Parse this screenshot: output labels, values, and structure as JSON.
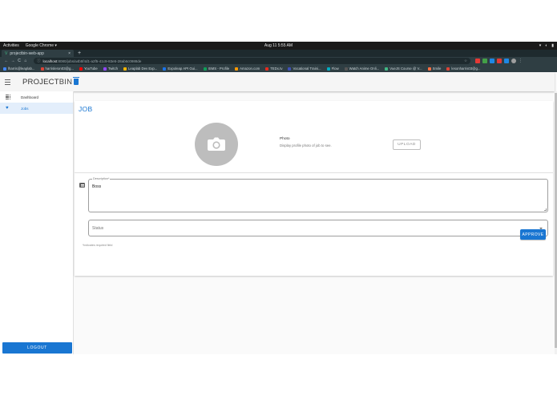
{
  "gnome": {
    "activities": "Activities",
    "app": "Google Chrome ▾",
    "clock": "Aug 11  5:55 AM",
    "tray": [
      "▾",
      "◐",
      "▮"
    ]
  },
  "browser": {
    "tab_title": "projectbin-web-app",
    "tab_close": "×",
    "new_tab": "+",
    "url_host": "localhost",
    "url_path": ":8080/jobs/a4b5f4d1-a2f5-41c9-83e5-28ab6c0988de",
    "nav": {
      "back": "←",
      "forward": "→",
      "reload": "C",
      "home": "⌂"
    }
  },
  "bookmarks": [
    {
      "label": "lharris@leaplab...",
      "color": "#4285f4"
    },
    {
      "label": "harrisleron03@g...",
      "color": "#db4437"
    },
    {
      "label": "YouTube",
      "color": "#ff0000"
    },
    {
      "label": "Twitch",
      "color": "#9146ff"
    },
    {
      "label": "Leaplab Dev Exp...",
      "color": "#f4b400"
    },
    {
      "label": "Expoleap API Gui...",
      "color": "#1a73e8"
    },
    {
      "label": "ISMS - Profile",
      "color": "#0f9d58"
    },
    {
      "label": "Amazon.com",
      "color": "#ff9900"
    },
    {
      "label": "TEDx.tv",
      "color": "#e62b1e"
    },
    {
      "label": "Vocational Traini...",
      "color": "#3f51b5"
    },
    {
      "label": "Flow",
      "color": "#00acc1"
    },
    {
      "label": "Watch Anime Onli...",
      "color": "#555555"
    },
    {
      "label": "VueJS Course @ V...",
      "color": "#41b883"
    },
    {
      "label": "Smile",
      "color": "#ff7043"
    },
    {
      "label": "lesonharris03@g...",
      "color": "#db4437"
    }
  ],
  "appbar": {
    "brand_project": "PROJECT",
    "brand_bin": "BIN"
  },
  "nav": {
    "items": [
      {
        "label": "Dashboard",
        "icon": "grid-icon"
      },
      {
        "label": "Jobs",
        "icon": "heart-icon"
      }
    ],
    "logout": "LOGOUT"
  },
  "job": {
    "title": "JOB",
    "photo_label": "Photo",
    "photo_help": "Display profile photo of job to see.",
    "upload": "UPLOAD",
    "description_label": "Description*",
    "description_value": "Boss",
    "status_placeholder": "Status",
    "approve": "APPROVE",
    "required_note": "*indicates required field"
  },
  "colors": {
    "primary": "#1976d2",
    "avatar": "#bdbdbd"
  }
}
